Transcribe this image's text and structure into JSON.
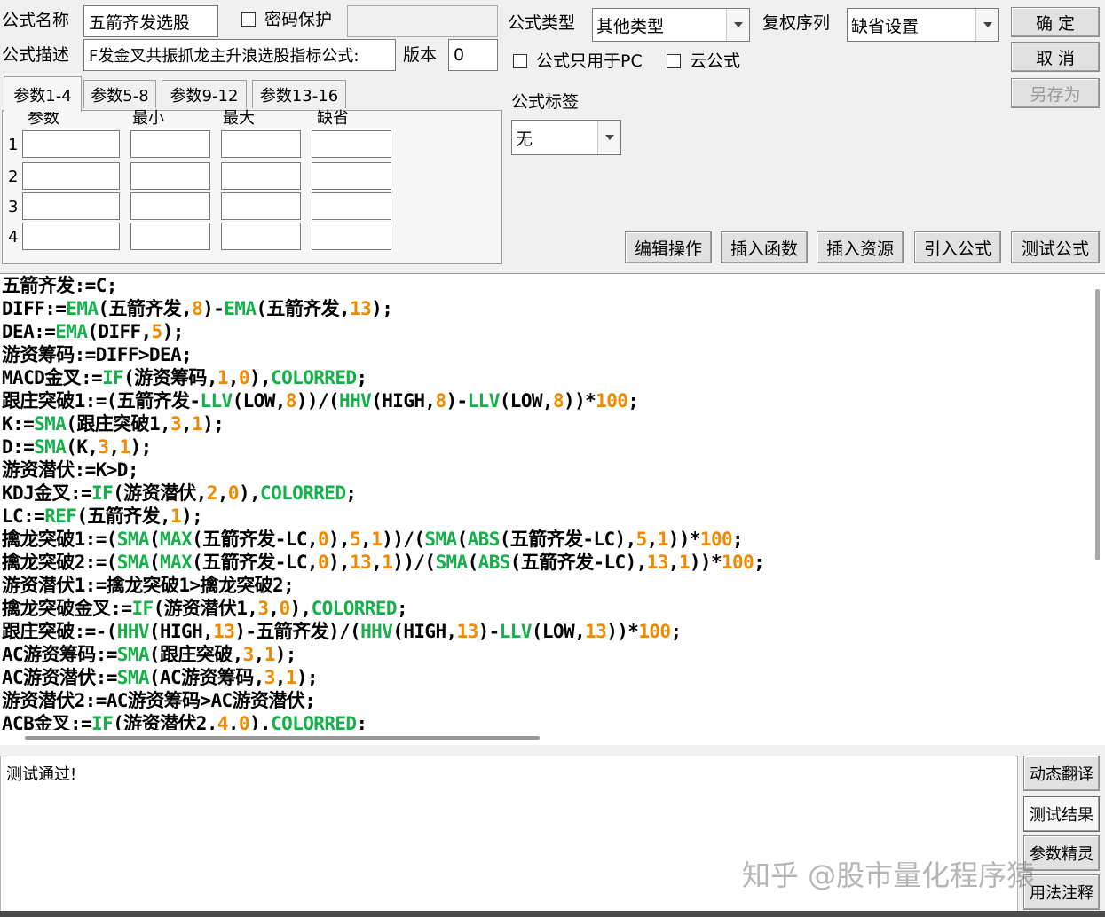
{
  "form": {
    "name_label": "公式名称",
    "name_value": "五箭齐发选股",
    "password_label": "密码保护",
    "desc_label": "公式描述",
    "desc_value": "F发金叉共振抓龙主升浪选股指标公式:",
    "version_label": "版本",
    "version_value": "0",
    "type_label": "公式类型",
    "type_value": "其他类型",
    "restore_label": "复权序列",
    "restore_value": "缺省设置",
    "pc_only_label": "公式只用于PC",
    "cloud_label": "云公式",
    "tag_label": "公式标签",
    "tag_value": "无"
  },
  "buttons": {
    "ok": "确 定",
    "cancel": "取 消",
    "save_as": "另存为",
    "edit_ops": "编辑操作",
    "insert_func": "插入函数",
    "insert_res": "插入资源",
    "import_formula": "引入公式",
    "test_formula": "测试公式"
  },
  "tabs": [
    "参数1-4",
    "参数5-8",
    "参数9-12",
    "参数13-16"
  ],
  "params": {
    "headers": [
      "参数",
      "最小",
      "最大",
      "缺省"
    ],
    "rows": [
      "1",
      "2",
      "3",
      "4"
    ]
  },
  "code_lines": [
    "五箭齐发:=C;",
    "DIFF:=EMA(五箭齐发,8)-EMA(五箭齐发,13);",
    "DEA:=EMA(DIFF,5);",
    "游资筹码:=DIFF>DEA;",
    "MACD金叉:=IF(游资筹码,1,0),COLORRED;",
    "跟庄突破1:=(五箭齐发-LLV(LOW,8))/(HHV(HIGH,8)-LLV(LOW,8))*100;",
    "K:=SMA(跟庄突破1,3,1);",
    "D:=SMA(K,3,1);",
    "游资潜伏:=K>D;",
    "KDJ金叉:=IF(游资潜伏,2,0),COLORRED;",
    "LC:=REF(五箭齐发,1);",
    "擒龙突破1:=(SMA(MAX(五箭齐发-LC,0),5,1))/(SMA(ABS(五箭齐发-LC),5,1))*100;",
    "擒龙突破2:=(SMA(MAX(五箭齐发-LC,0),13,1))/(SMA(ABS(五箭齐发-LC),13,1))*100;",
    "游资潜伏1:=擒龙突破1>擒龙突破2;",
    "擒龙突破金叉:=IF(游资潜伏1,3,0),COLORRED;",
    "跟庄突破:=-(HHV(HIGH,13)-五箭齐发)/(HHV(HIGH,13)-LLV(LOW,13))*100;",
    "AC游资筹码:=SMA(跟庄突破,3,1);",
    "AC游资潜伏:=SMA(AC游资筹码,3,1);",
    "游资潜伏2:=AC游资筹码>AC游资潜伏;",
    "ACB金叉:=IF(游资潜伏2,4,0),COLORRED;"
  ],
  "code_colors": {
    "func": "#16b04a",
    "number": "#ef8a00",
    "text": "#000000"
  },
  "result_text": "测试通过!",
  "side_buttons": [
    "动态翻译",
    "测试结果",
    "参数精灵",
    "用法注释"
  ],
  "watermark": "知乎 @股市量化程序猿"
}
